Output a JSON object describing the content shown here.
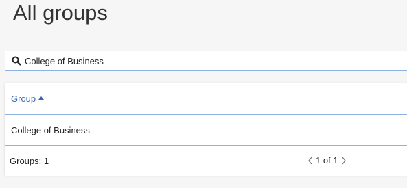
{
  "page": {
    "title": "All groups"
  },
  "search": {
    "value": "College of Business",
    "icon": "search-icon"
  },
  "table": {
    "columns": [
      {
        "label": "Group",
        "sort": "ascending"
      }
    ],
    "rows": [
      {
        "group": "College of Business"
      }
    ]
  },
  "footer": {
    "count_label": "Groups: 1",
    "page_text": "1 of 1",
    "current_page": 1,
    "total_pages": 1
  },
  "colors": {
    "accent": "#3a66b0",
    "border": "#8fb3e0"
  }
}
